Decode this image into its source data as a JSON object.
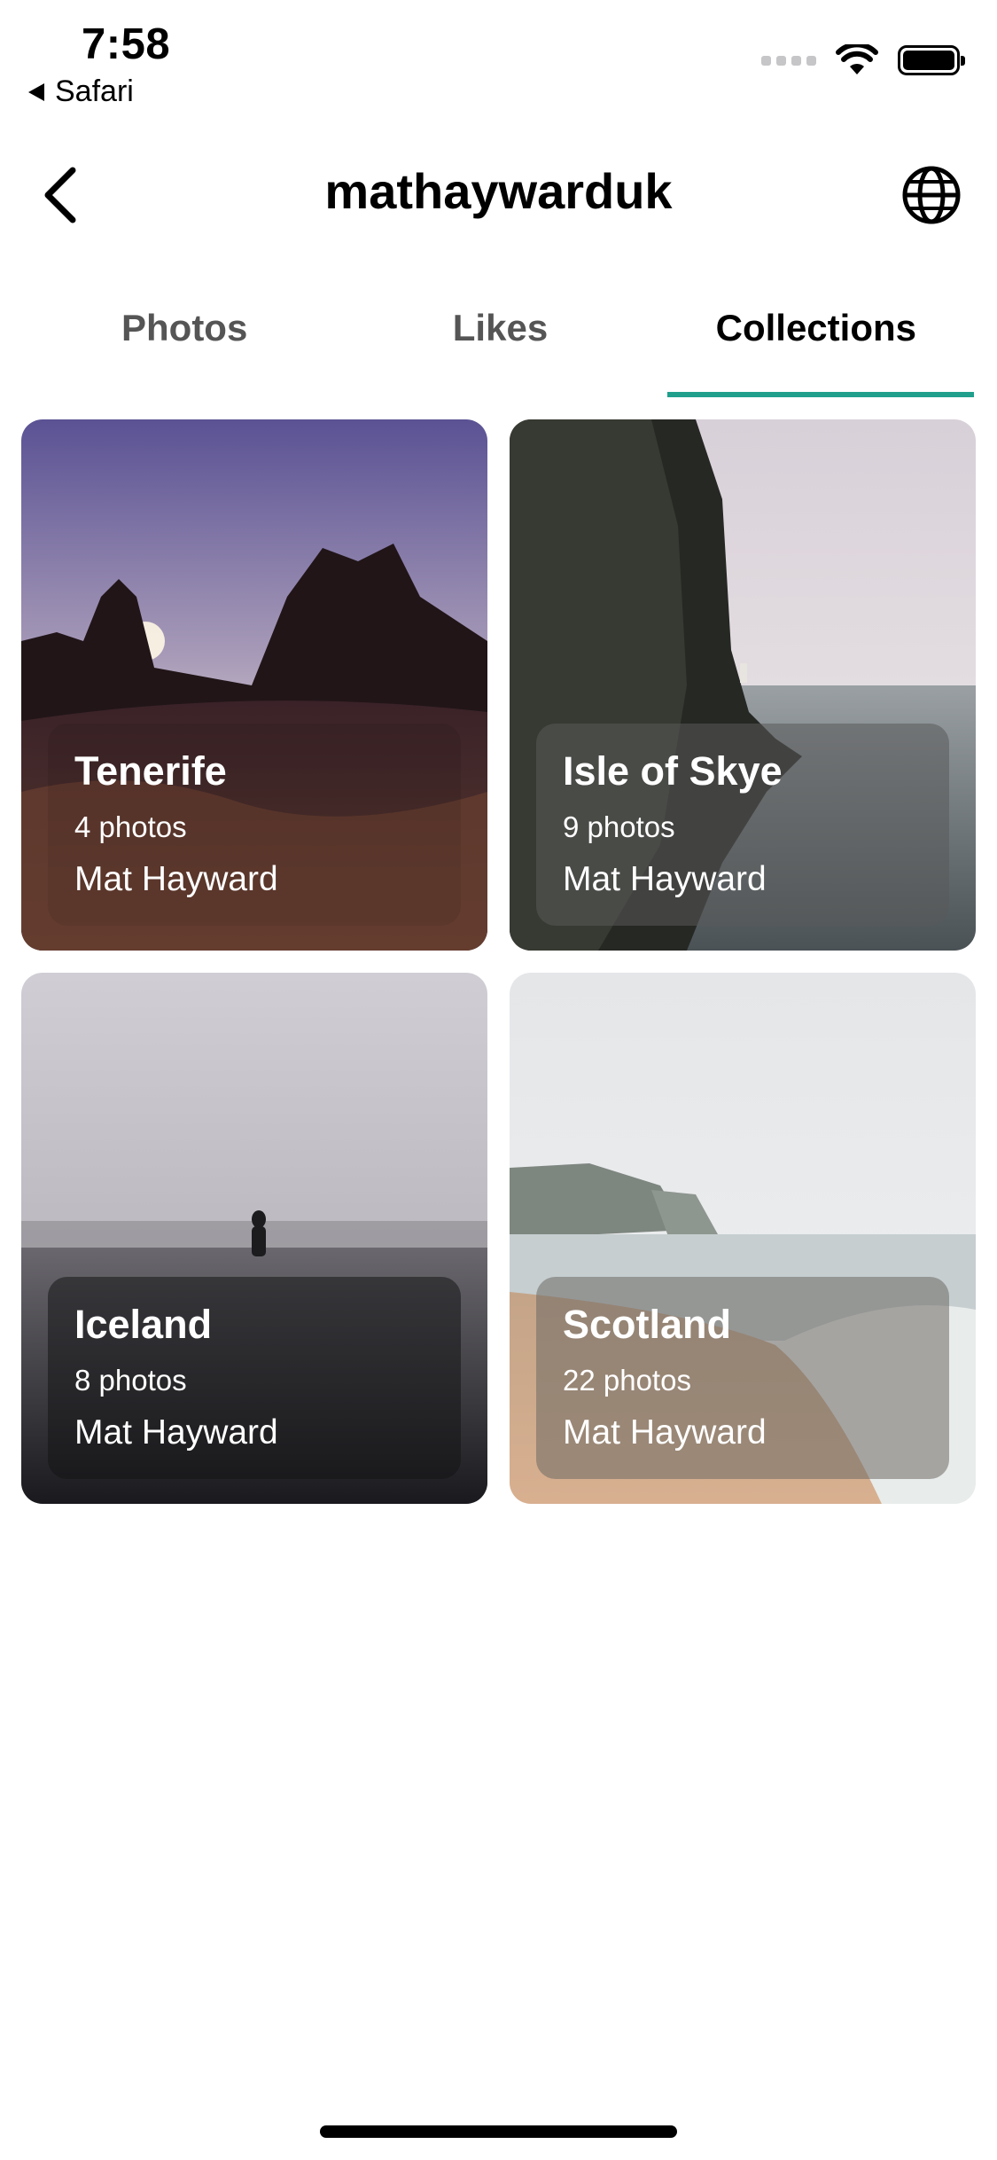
{
  "status_bar": {
    "time": "7:58",
    "back_app": "Safari",
    "icons": [
      "signal-icon",
      "wifi-icon",
      "battery-icon"
    ]
  },
  "nav": {
    "title": "mathaywarduk",
    "back_icon": "chevron-left-icon",
    "globe_icon": "globe-icon"
  },
  "tabs": [
    {
      "label": "Photos",
      "active": false
    },
    {
      "label": "Likes",
      "active": false
    },
    {
      "label": "Collections",
      "active": true
    }
  ],
  "collections": [
    {
      "title": "Tenerife",
      "count": "4 photos",
      "author": "Mat Hayward"
    },
    {
      "title": "Isle of Skye",
      "count": "9 photos",
      "author": "Mat Hayward"
    },
    {
      "title": "Iceland",
      "count": "8 photos",
      "author": "Mat Hayward"
    },
    {
      "title": "Scotland",
      "count": "22 photos",
      "author": "Mat Hayward"
    }
  ],
  "colors": {
    "accent": "#1f9f8c",
    "tab_inactive": "#555555"
  }
}
